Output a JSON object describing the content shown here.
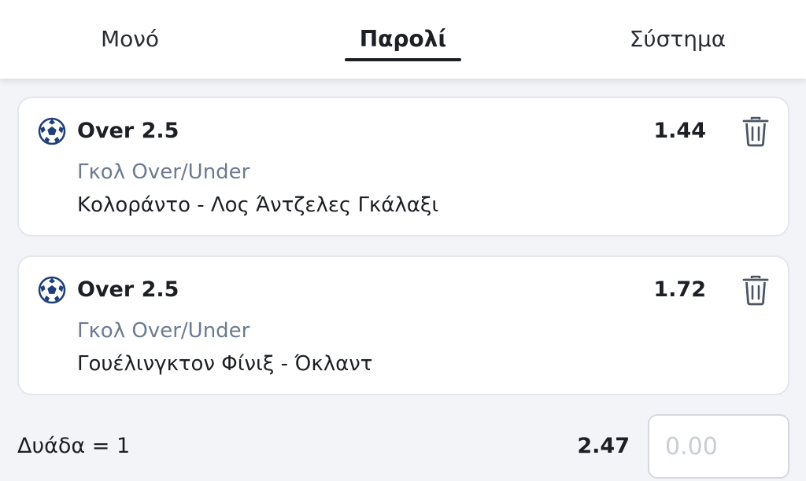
{
  "tabs": {
    "single": "Μονό",
    "parlay": "Παρολί",
    "system": "Σύστημα",
    "active": "parlay"
  },
  "bets": [
    {
      "selection": "Over 2.5",
      "odds": "1.44",
      "market": "Γκολ Over/Under",
      "match": "Κολοράντο - Λος Άντζελες Γκάλαξι",
      "icon": "soccer-ball-icon"
    },
    {
      "selection": "Over 2.5",
      "odds": "1.72",
      "market": "Γκολ Over/Under",
      "match": "Γουέλινγκτον Φίνιξ - Όκλαντ",
      "icon": "soccer-ball-icon"
    }
  ],
  "footer": {
    "combo_label": "Δυάδα = 1",
    "total_odds": "2.47",
    "stake_placeholder": "0.00"
  },
  "colors": {
    "accent": "#1c1f24",
    "market_text": "#6c7b92",
    "icon_blue": "#1e3f7a",
    "background": "#f3f4f7"
  }
}
